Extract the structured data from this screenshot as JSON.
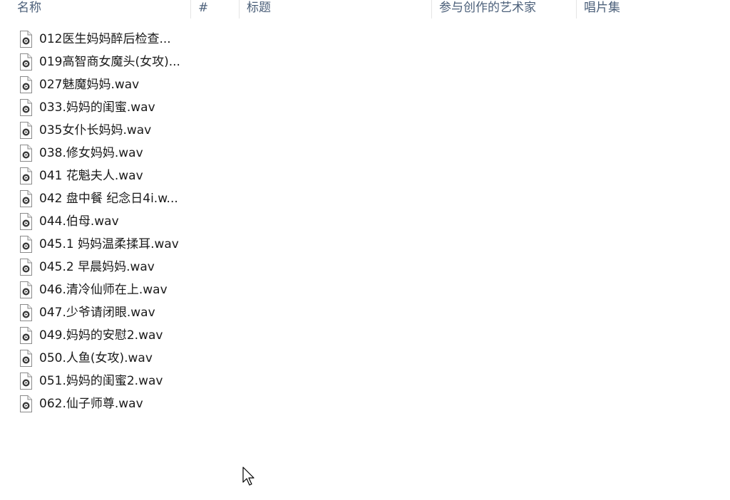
{
  "columns": [
    {
      "id": "name",
      "label": "名称"
    },
    {
      "id": "number",
      "label": "#"
    },
    {
      "id": "title",
      "label": "标题"
    },
    {
      "id": "artists",
      "label": "参与创作的艺术家"
    },
    {
      "id": "album",
      "label": "唱片集"
    }
  ],
  "files": [
    {
      "name": "012医生妈妈醉后检查..."
    },
    {
      "name": "019高智商女魔头(女攻)..."
    },
    {
      "name": "027魅魔妈妈.wav"
    },
    {
      "name": "033.妈妈的闺蜜.wav"
    },
    {
      "name": "035女仆长妈妈.wav"
    },
    {
      "name": "038.修女妈妈.wav"
    },
    {
      "name": "041 花魁夫人.wav"
    },
    {
      "name": "042 盘中餐 纪念日4i.w..."
    },
    {
      "name": "044.伯母.wav"
    },
    {
      "name": "045.1 妈妈温柔揉耳.wav"
    },
    {
      "name": "045.2 早晨妈妈.wav"
    },
    {
      "name": "046.清冷仙师在上.wav"
    },
    {
      "name": "047.少爷请闭眼.wav"
    },
    {
      "name": "049.妈妈的安慰2.wav"
    },
    {
      "name": "050.人鱼(女攻).wav"
    },
    {
      "name": "051.妈妈的闺蜜2.wav"
    },
    {
      "name": "062.仙子师尊.wav"
    }
  ],
  "icons": {
    "file": "audio-file-icon",
    "cursor": "mouse-pointer-icon"
  },
  "colors": {
    "header_text": "#4c607a",
    "file_text": "#1a1a1a",
    "divider": "#e5e5e5",
    "background": "#ffffff"
  }
}
